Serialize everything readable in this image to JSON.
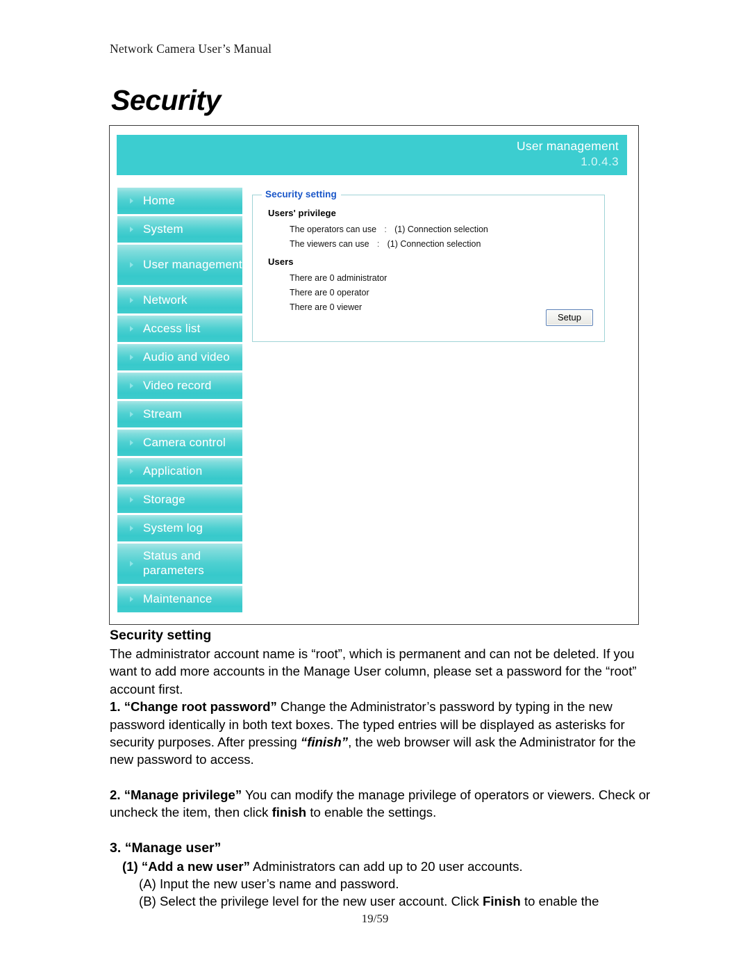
{
  "document": {
    "running_head": "Network Camera User’s Manual",
    "chapter_title": "Security",
    "page_number": "19/59"
  },
  "screenshot": {
    "header": {
      "app_title": "User management",
      "version": "1.0.4.3",
      "background_color": "#3ccdd0"
    },
    "sidebar": {
      "items": [
        {
          "label": "Home",
          "lines": 1
        },
        {
          "label": "System",
          "lines": 1
        },
        {
          "label": "User management",
          "lines": 2
        },
        {
          "label": "Network",
          "lines": 1
        },
        {
          "label": "Access list",
          "lines": 1
        },
        {
          "label": "Audio and video",
          "lines": 1
        },
        {
          "label": "Video record",
          "lines": 1
        },
        {
          "label": "Stream",
          "lines": 1
        },
        {
          "label": "Camera control",
          "lines": 1
        },
        {
          "label": "Application",
          "lines": 1
        },
        {
          "label": "Storage",
          "lines": 1
        },
        {
          "label": "System log",
          "lines": 1
        },
        {
          "label": "Status and parameters",
          "lines": 2
        },
        {
          "label": "Maintenance",
          "lines": 1
        }
      ]
    },
    "panel": {
      "legend": "Security setting",
      "legend_color": "#1956c8",
      "privilege_heading": "Users' privilege",
      "privilege_rows": [
        {
          "label": "The operators can use",
          "separator": ":",
          "value": "(1) Connection selection"
        },
        {
          "label": "The viewers can use",
          "separator": ":",
          "value": "(1) Connection selection"
        }
      ],
      "users_heading": "Users",
      "users_rows": [
        "There are 0 administrator",
        "There are 0 operator",
        "There are 0 viewer"
      ],
      "setup_button": "Setup"
    }
  },
  "content": {
    "section_heading": "Security setting",
    "intro": "The administrator account name is “root”, which is permanent and can not be deleted. If you want to add more accounts in the Manage User column, please set a password for the “root” account first.",
    "item1_num": "1.",
    "item1_title": "“Change root password”",
    "item1_body_a": " Change the Administrator’s password by typing in the new password identically in both text boxes. The typed entries will be displayed as asterisks for security purposes. After pressing ",
    "item1_emphasis": "“finish”",
    "item1_body_b": ", the web browser will ask the Administrator for the new password to access.",
    "item2_num": "2.",
    "item2_title": "“Manage privilege”",
    "item2_body_a": " You can modify the manage privilege of operators or viewers. Check or uncheck the item, then click ",
    "item2_emphasis": "finish",
    "item2_body_b": " to enable the settings.",
    "item3_num": "3.",
    "item3_title": "“Manage user”",
    "item3_sub1_num": "(1)",
    "item3_sub1_title": "“Add a new user”",
    "item3_sub1_body": " Administrators can add up to 20 user accounts.",
    "item3_sub_a": "(A) Input the new user’s name and password.",
    "item3_sub_b_a": "(B) Select the privilege level for the new user account. Click ",
    "item3_sub_b_emphasis": "Finish",
    "item3_sub_b_b": " to enable the"
  }
}
